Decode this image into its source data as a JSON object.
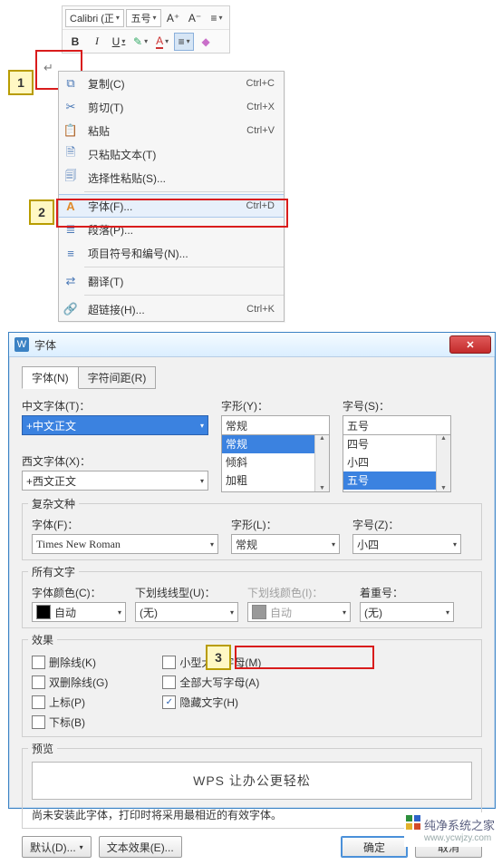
{
  "toolbar": {
    "font_name": "Calibri (正",
    "font_size": "五号",
    "grow_label": "A⁺",
    "shrink_label": "A⁻",
    "bold": "B",
    "italic": "I",
    "underline": "U"
  },
  "callouts": {
    "c1": "1",
    "c2": "2",
    "c3": "3"
  },
  "context_menu": {
    "items": [
      {
        "icon": "⧉",
        "label": "复制(C)",
        "shortcut": "Ctrl+C"
      },
      {
        "icon": "✂",
        "label": "剪切(T)",
        "shortcut": "Ctrl+X"
      },
      {
        "icon": "📋",
        "label": "粘贴",
        "shortcut": "Ctrl+V"
      },
      {
        "icon": "🗎",
        "label": "只粘贴文本(T)",
        "shortcut": ""
      },
      {
        "icon": "🗐",
        "label": "选择性粘贴(S)...",
        "shortcut": ""
      },
      {
        "sep": true
      },
      {
        "icon": "A",
        "label": "字体(F)...",
        "shortcut": "Ctrl+D",
        "highlight": true,
        "orange": true
      },
      {
        "icon": "≣",
        "label": "段落(P)...",
        "shortcut": ""
      },
      {
        "icon": "≡",
        "label": "项目符号和编号(N)...",
        "shortcut": ""
      },
      {
        "sep": true
      },
      {
        "icon": "⇄",
        "label": "翻译(T)",
        "shortcut": ""
      },
      {
        "sep": true
      },
      {
        "icon": "🔗",
        "label": "超链接(H)...",
        "shortcut": "Ctrl+K"
      }
    ]
  },
  "dialog": {
    "title": "字体",
    "tabs": {
      "font": "字体(N)",
      "spacing": "字符间距(R)"
    },
    "cn_font_label": "中文字体(T)：",
    "cn_font_value": "+中文正文",
    "en_font_label": "西文字体(X)：",
    "en_font_value": "+西文正文",
    "style_label": "字形(Y)：",
    "style_value": "常规",
    "style_options": [
      "常规",
      "倾斜",
      "加粗"
    ],
    "size_label": "字号(S)：",
    "size_value": "五号",
    "size_options": [
      "四号",
      "小四",
      "五号"
    ],
    "complex": {
      "group": "复杂文种",
      "font_label": "字体(F)：",
      "font_value": "Times New Roman",
      "style_label": "字形(L)：",
      "style_value": "常规",
      "size_label": "字号(Z)：",
      "size_value": "小四"
    },
    "all_text": {
      "group": "所有文字",
      "color_label": "字体颜色(C)：",
      "color_value": "自动",
      "underline_label": "下划线线型(U)：",
      "underline_value": "(无)",
      "underline_color_label": "下划线颜色(I)：",
      "underline_color_value": "自动",
      "emphasis_label": "着重号：",
      "emphasis_value": "(无)"
    },
    "effects": {
      "group": "效果",
      "strike": "删除线(K)",
      "dstrike": "双删除线(G)",
      "super": "上标(P)",
      "sub": "下标(B)",
      "smallcaps": "小型大写字母(M)",
      "allcaps": "全部大写字母(A)",
      "hidden": "隐藏文字(H)"
    },
    "preview": {
      "group": "预览",
      "text": "WPS 让办公更轻松"
    },
    "note": "尚未安装此字体，打印时将采用最相近的有效字体。",
    "buttons": {
      "defaults": "默认(D)...",
      "text_effects": "文本效果(E)...",
      "ok": "确定",
      "cancel": "取消"
    }
  },
  "watermark": "纯净系统之家"
}
